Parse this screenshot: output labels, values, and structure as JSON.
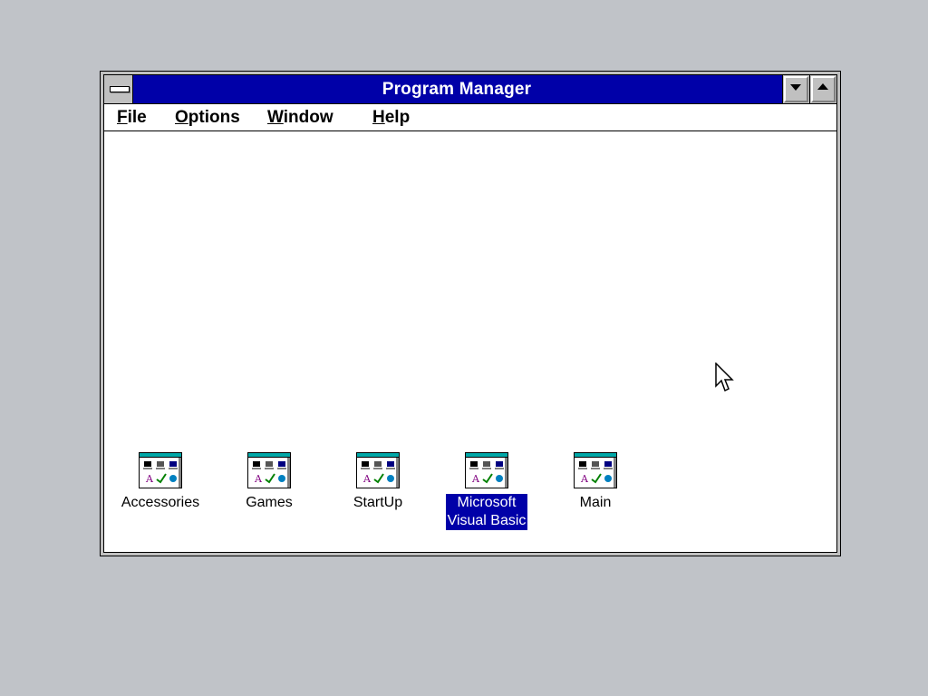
{
  "window": {
    "title": "Program Manager",
    "system_menu_icon": "system-menu-bar-icon",
    "minimize_icon": "minimize-arrow-icon",
    "maximize_icon": "maximize-arrow-icon"
  },
  "menu": {
    "items": [
      {
        "label_ul": "F",
        "label_rest": "ile"
      },
      {
        "label_ul": "O",
        "label_rest": "ptions"
      },
      {
        "label_ul": "W",
        "label_rest": "indow"
      },
      {
        "label_ul": "H",
        "label_rest": "elp"
      }
    ]
  },
  "groups": [
    {
      "label_line1": "Accessories",
      "label_line2": "",
      "icon": "program-group-icon",
      "selected": false
    },
    {
      "label_line1": "Games",
      "label_line2": "",
      "icon": "program-group-icon",
      "selected": false
    },
    {
      "label_line1": "StartUp",
      "label_line2": "",
      "icon": "program-group-icon",
      "selected": false
    },
    {
      "label_line1": "Microsoft",
      "label_line2": "Visual Basic",
      "icon": "program-group-icon",
      "selected": true
    },
    {
      "label_line1": "Main",
      "label_line2": "",
      "icon": "program-group-icon",
      "selected": false
    }
  ],
  "colors": {
    "desktop": "#c0c3c8",
    "titlebar": "#0000a8",
    "selection": "#0000a8",
    "window_bg": "#ffffff"
  },
  "cursor_icon": "arrow-pointer-icon"
}
